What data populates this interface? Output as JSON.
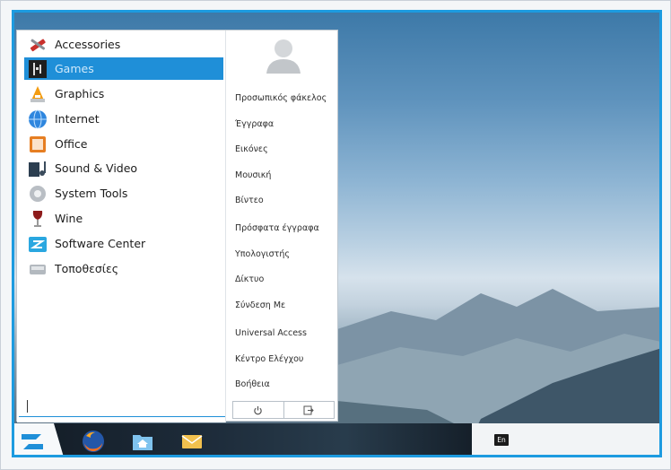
{
  "start_menu": {
    "categories": [
      {
        "label": "Accessories",
        "icon": "accessories-icon"
      },
      {
        "label": "Games",
        "icon": "games-icon",
        "selected": true
      },
      {
        "label": "Graphics",
        "icon": "graphics-icon"
      },
      {
        "label": "Internet",
        "icon": "internet-icon"
      },
      {
        "label": "Office",
        "icon": "office-icon"
      },
      {
        "label": "Sound & Video",
        "icon": "sound-video-icon"
      },
      {
        "label": "System Tools",
        "icon": "system-tools-icon"
      },
      {
        "label": "Wine",
        "icon": "wine-icon"
      },
      {
        "label": "Software Center",
        "icon": "software-center-icon"
      },
      {
        "label": "Τοποθεσίες",
        "icon": "places-icon"
      }
    ],
    "search": {
      "value": ""
    },
    "places": [
      "Προσωπικός φάκελος",
      "Έγγραφα",
      "Εικόνες",
      "Μουσική",
      "Βίντεο",
      "Πρόσφατα έγγραφα",
      "Υπολογιστής",
      "Δίκτυο",
      "Σύνδεση Με",
      "Universal Access",
      "Κέντρο Ελέγχου",
      "Βοήθεια"
    ],
    "power_icon": "power-icon",
    "logout_icon": "logout-icon"
  },
  "taskbar": {
    "launchers": [
      "firefox-icon",
      "home-folder-icon",
      "mail-icon"
    ],
    "language": "En"
  },
  "colors": {
    "accent": "#1f8fd8",
    "frame_border": "#1d9be0",
    "taskbar_dark": "#1e2c3a"
  }
}
